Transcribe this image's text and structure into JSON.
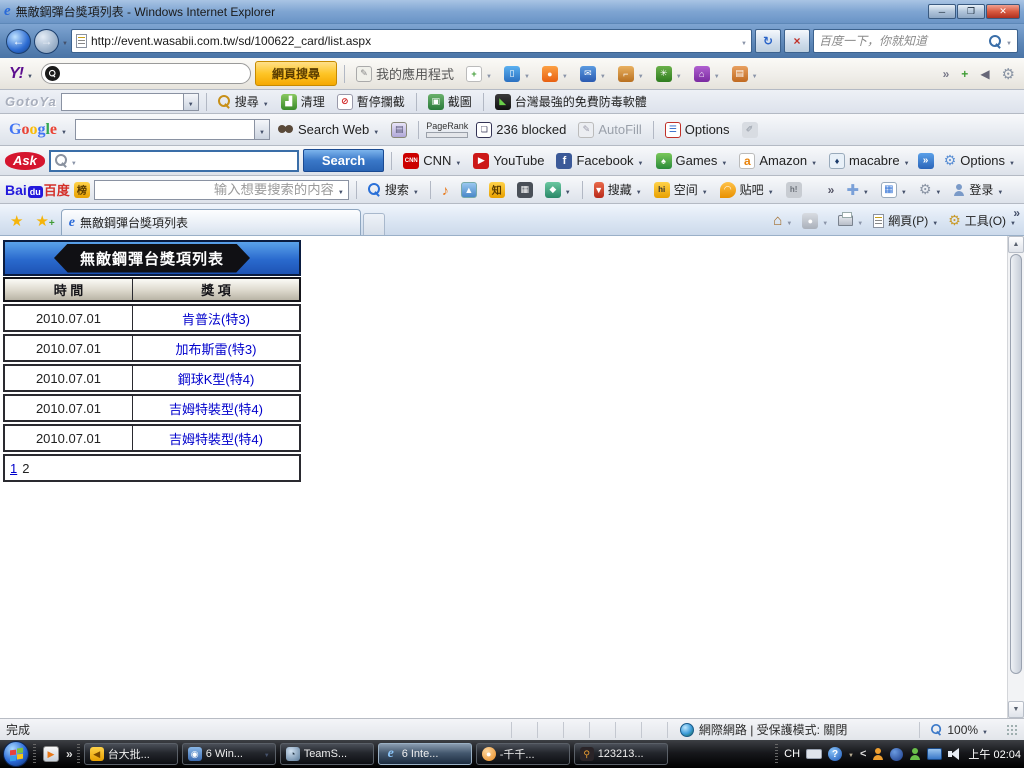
{
  "window": {
    "title": "無敵鋼彈台獎項列表 - Windows Internet Explorer"
  },
  "address": {
    "url": "http://event.wasabii.com.tw/sd/100622_card/list.aspx",
    "search_placeholder": "百度一下，你就知道"
  },
  "yahoo": {
    "logo": "Y!",
    "search_button": "網頁搜尋",
    "my_apps": "我的應用程式"
  },
  "gotoya": {
    "logo": "GotoYa",
    "search": "搜尋",
    "clean": "清理",
    "pause_block": "暫停攔截",
    "capture": "截圖",
    "antivirus": "台灣最強的免費防毒軟體"
  },
  "google": {
    "g1": "G",
    "g2": "o",
    "g3": "o",
    "g4": "g",
    "g5": "l",
    "g6": "e",
    "search_web": "Search Web",
    "pagerank": "PageRank",
    "blocked": "236 blocked",
    "autofill": "AutoFill",
    "options": "Options"
  },
  "ask": {
    "logo": "Ask",
    "search_button": "Search",
    "cnn": "CNN",
    "youtube": "YouTube",
    "facebook": "Facebook",
    "games": "Games",
    "amazon": "Amazon",
    "macabre": "macabre",
    "options": "Options"
  },
  "baidu": {
    "bai": "Bai",
    "du": "du",
    "cn": "百度",
    "badge": "榜",
    "placeholder": "输入想要搜索的内容",
    "search": "搜索",
    "zhi": "知",
    "fav": "搜藏",
    "hi": "hi",
    "space": "空间",
    "tieba": "贴吧",
    "hfeed": "h!",
    "login": "登录"
  },
  "tabbar": {
    "tab_title": "無敵鋼彈台獎項列表",
    "page_menu": "網頁(P)",
    "tools_menu": "工具(O)"
  },
  "page": {
    "banner": "無敵鋼彈台獎項列表",
    "col_time": "時 間",
    "col_award": "獎 項",
    "rows": [
      {
        "date": "2010.07.01",
        "award": "肯普法(特3)"
      },
      {
        "date": "2010.07.01",
        "award": "加布斯雷(特3)"
      },
      {
        "date": "2010.07.01",
        "award": "鋼球K型(特4)"
      },
      {
        "date": "2010.07.01",
        "award": "吉姆特裝型(特4)"
      },
      {
        "date": "2010.07.01",
        "award": "吉姆特裝型(特4)"
      }
    ],
    "page_link": "1",
    "page_current": "2"
  },
  "status": {
    "done": "完成",
    "zone": "網際網路 | 受保護模式: 關閉",
    "zoom": "100%"
  },
  "taskbar": {
    "buttons": [
      "台大批...",
      "6 Win...",
      "TeamS...",
      "6 Inte...",
      "-千千...",
      "123213..."
    ],
    "lang": "CH",
    "time": "上午 02:04"
  }
}
